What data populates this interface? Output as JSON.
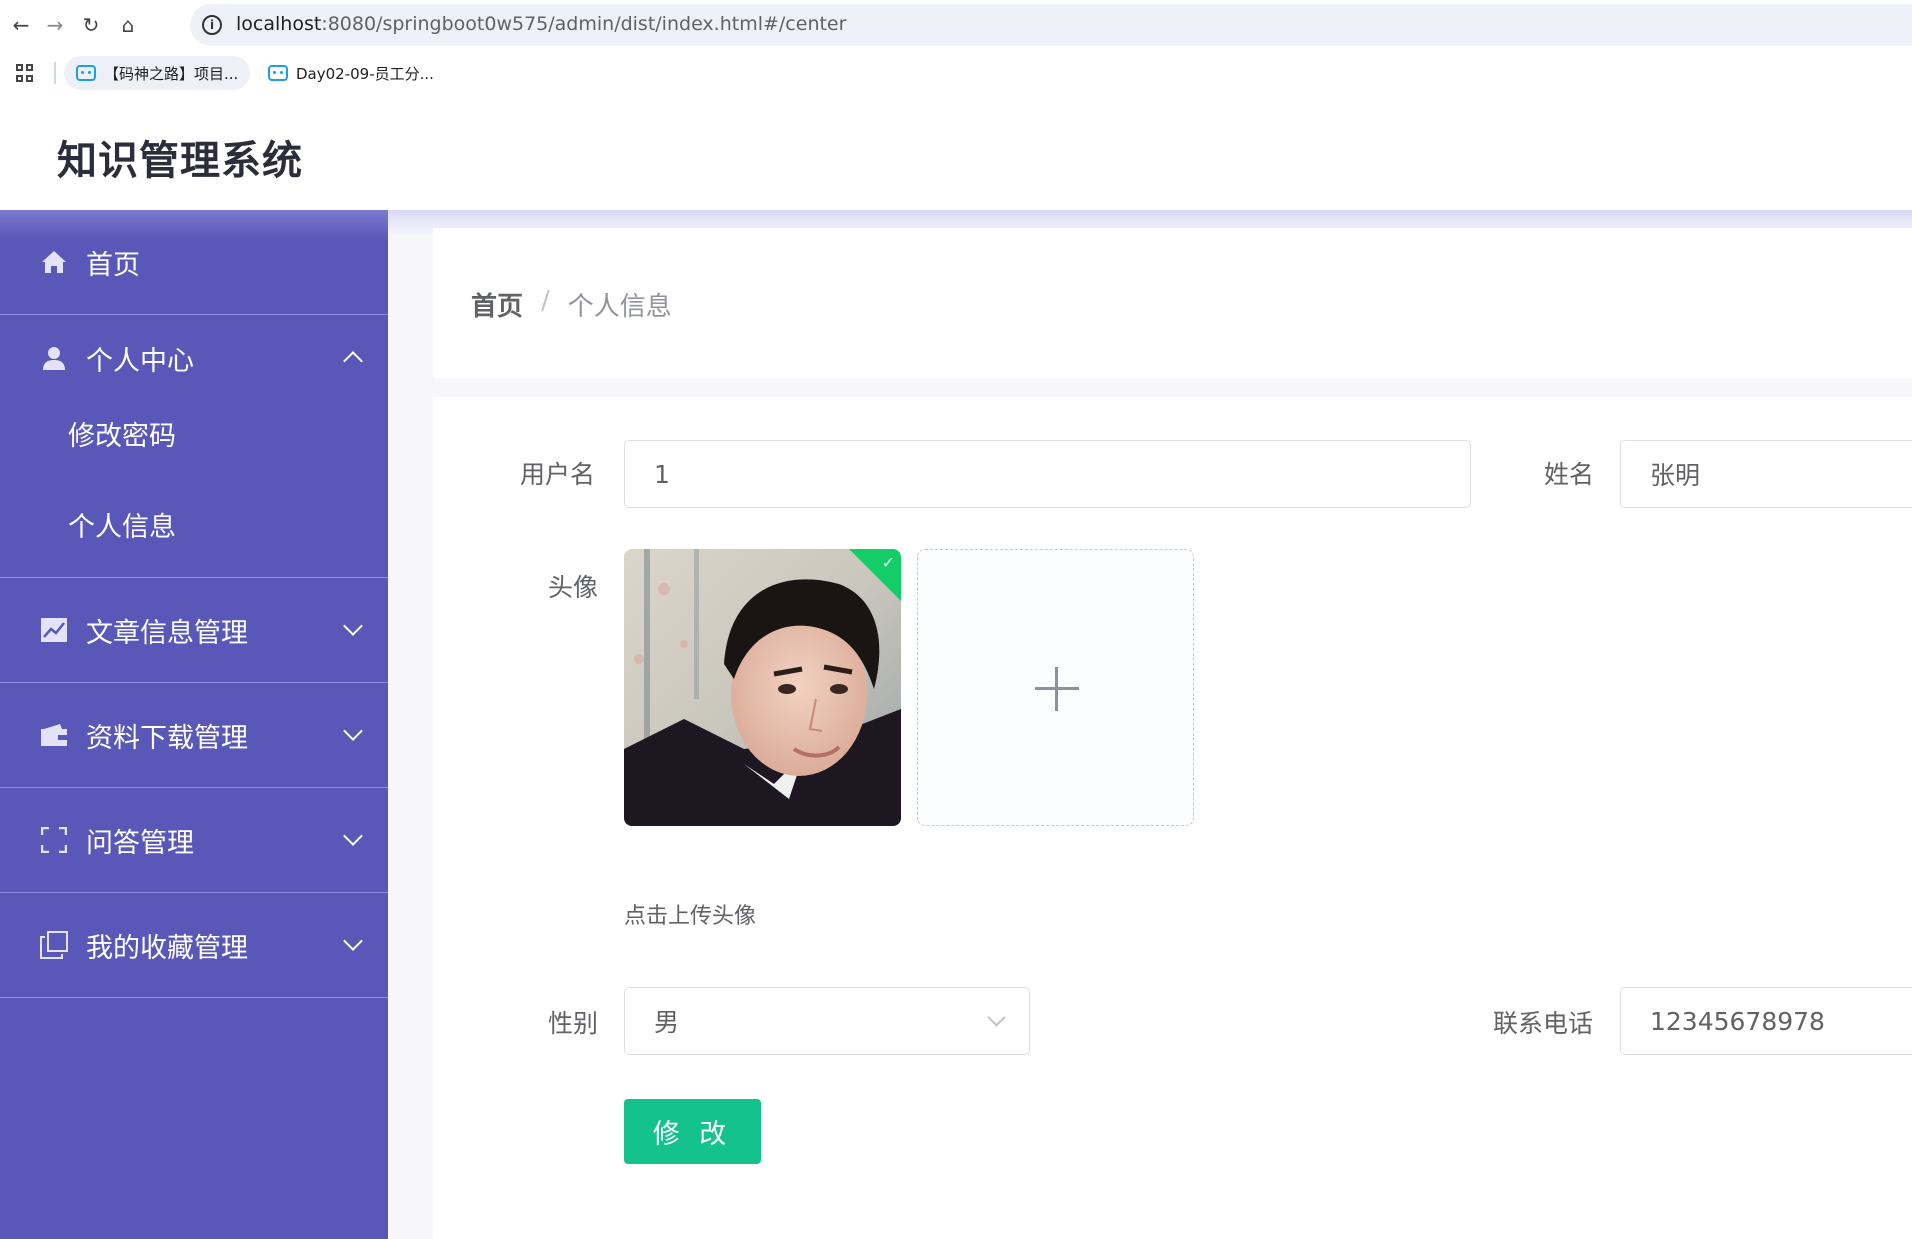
{
  "browser": {
    "url_host": "localhost",
    "url_rest": ":8080/springboot0w575/admin/dist/index.html#/center",
    "bookmarks": [
      {
        "label": "【码神之路】项目..."
      },
      {
        "label": "Day02-09-员工分..."
      }
    ]
  },
  "app": {
    "title": "知识管理系统"
  },
  "sidebar": {
    "items": [
      {
        "label": "首页",
        "icon": "home-icon",
        "expanded": null
      },
      {
        "label": "个人中心",
        "icon": "user-icon",
        "expanded": true,
        "children": [
          {
            "label": "修改密码"
          },
          {
            "label": "个人信息"
          }
        ]
      },
      {
        "label": "文章信息管理",
        "icon": "chart-icon",
        "expanded": false
      },
      {
        "label": "资料下载管理",
        "icon": "wallet-icon",
        "expanded": false
      },
      {
        "label": "问答管理",
        "icon": "fullscreen-icon",
        "expanded": false
      },
      {
        "label": "我的收藏管理",
        "icon": "copy-icon",
        "expanded": false
      }
    ]
  },
  "breadcrumb": {
    "home": "首页",
    "separator": "/",
    "current": "个人信息"
  },
  "form": {
    "username_label": "用户名",
    "username_value": "1",
    "name_label": "姓名",
    "name_value": "张明",
    "avatar_label": "头像",
    "upload_tip": "点击上传头像",
    "gender_label": "性别",
    "gender_value": "男",
    "phone_label": "联系电话",
    "phone_value": "12345678978",
    "submit_label": "修 改"
  },
  "colors": {
    "sidebar_bg": "#5958b8",
    "submit_button": "#13c28d",
    "upload_success": "#13ce66"
  }
}
